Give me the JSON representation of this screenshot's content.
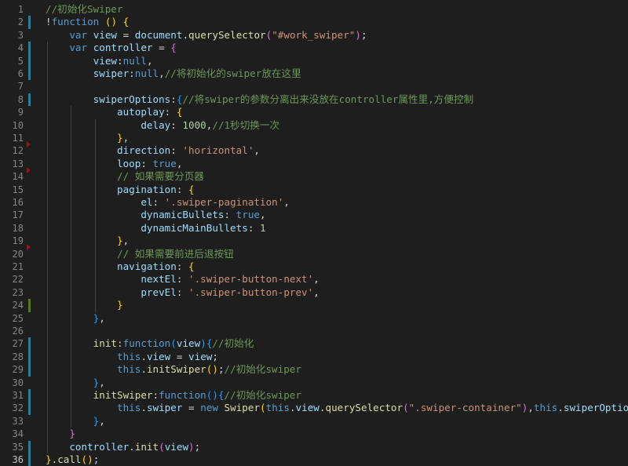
{
  "colors": {
    "background": "#1e1e1e",
    "comment": "#6a9955",
    "keyword": "#569cd6",
    "function": "#dcdcaa",
    "variable": "#9cdcfe",
    "string": "#ce9178",
    "number": "#b5cea8",
    "bracket_1": "#ffd700",
    "bracket_2": "#da70d6",
    "bracket_3": "#179fff",
    "diff_modified": "#1b81a8",
    "diff_added": "#587c0c",
    "diff_deleted": "#94151b"
  },
  "editor": {
    "active_line": 36,
    "lines": [
      {
        "n": "1",
        "gutter": "",
        "tokens": [
          [
            "com",
            "//初始化Swiper"
          ]
        ]
      },
      {
        "n": "2",
        "gutter": "mod",
        "tokens": [
          [
            "pun",
            "!"
          ],
          [
            "kw",
            "function"
          ],
          [
            "pun",
            " "
          ],
          [
            "p1",
            "()"
          ],
          [
            "pun",
            " "
          ],
          [
            "p1",
            "{"
          ]
        ]
      },
      {
        "n": "3",
        "gutter": "",
        "tokens": [
          [
            "pun",
            "    "
          ],
          [
            "kw",
            "var"
          ],
          [
            "pun",
            " "
          ],
          [
            "var",
            "view"
          ],
          [
            "pun",
            " = "
          ],
          [
            "var",
            "document"
          ],
          [
            "pun",
            "."
          ],
          [
            "fn",
            "querySelector"
          ],
          [
            "p2",
            "("
          ],
          [
            "str",
            "\"#work_swiper\""
          ],
          [
            "p2",
            ")"
          ],
          [
            "pun",
            ";"
          ]
        ]
      },
      {
        "n": "4",
        "gutter": "mod",
        "tokens": [
          [
            "pun",
            "    "
          ],
          [
            "kw",
            "var"
          ],
          [
            "pun",
            " "
          ],
          [
            "var",
            "controller"
          ],
          [
            "pun",
            " = "
          ],
          [
            "p2",
            "{"
          ]
        ]
      },
      {
        "n": "5",
        "gutter": "mod",
        "tokens": [
          [
            "pun",
            "        "
          ],
          [
            "var",
            "view"
          ],
          [
            "pun",
            ":"
          ],
          [
            "kw",
            "null"
          ],
          [
            "pun",
            ","
          ]
        ]
      },
      {
        "n": "6",
        "gutter": "mod",
        "tokens": [
          [
            "pun",
            "        "
          ],
          [
            "var",
            "swiper"
          ],
          [
            "pun",
            ":"
          ],
          [
            "kw",
            "null"
          ],
          [
            "pun",
            ","
          ],
          [
            "com",
            "//将初始化的swiper放在这里"
          ]
        ]
      },
      {
        "n": "7",
        "gutter": "",
        "tokens": []
      },
      {
        "n": "8",
        "gutter": "mod",
        "tokens": [
          [
            "pun",
            "        "
          ],
          [
            "var",
            "swiperOptions"
          ],
          [
            "pun",
            ":"
          ],
          [
            "p3",
            "{"
          ],
          [
            "com",
            "//将swiper的参数分离出来没放在controller属性里,方便控制"
          ]
        ]
      },
      {
        "n": "9",
        "gutter": "",
        "tokens": [
          [
            "pun",
            "            "
          ],
          [
            "var",
            "autoplay"
          ],
          [
            "pun",
            ": "
          ],
          [
            "p1",
            "{"
          ]
        ]
      },
      {
        "n": "10",
        "gutter": "",
        "tokens": [
          [
            "pun",
            "                "
          ],
          [
            "var",
            "delay"
          ],
          [
            "pun",
            ": "
          ],
          [
            "num",
            "1000"
          ],
          [
            "pun",
            ","
          ],
          [
            "com",
            "//1秒切换一次"
          ]
        ]
      },
      {
        "n": "11",
        "gutter": "del",
        "tokens": [
          [
            "pun",
            "            "
          ],
          [
            "p1",
            "}"
          ],
          [
            "pun",
            ","
          ]
        ]
      },
      {
        "n": "12",
        "gutter": "",
        "tokens": [
          [
            "pun",
            "            "
          ],
          [
            "var",
            "direction"
          ],
          [
            "pun",
            ": "
          ],
          [
            "str",
            "'horizontal'"
          ],
          [
            "pun",
            ","
          ]
        ]
      },
      {
        "n": "13",
        "gutter": "del",
        "tokens": [
          [
            "pun",
            "            "
          ],
          [
            "var",
            "loop"
          ],
          [
            "pun",
            ": "
          ],
          [
            "kw",
            "true"
          ],
          [
            "pun",
            ","
          ]
        ]
      },
      {
        "n": "14",
        "gutter": "",
        "tokens": [
          [
            "pun",
            "            "
          ],
          [
            "com",
            "// 如果需要分页器"
          ]
        ]
      },
      {
        "n": "15",
        "gutter": "",
        "tokens": [
          [
            "pun",
            "            "
          ],
          [
            "var",
            "pagination"
          ],
          [
            "pun",
            ": "
          ],
          [
            "p1",
            "{"
          ]
        ]
      },
      {
        "n": "16",
        "gutter": "",
        "tokens": [
          [
            "pun",
            "                "
          ],
          [
            "var",
            "el"
          ],
          [
            "pun",
            ": "
          ],
          [
            "str",
            "'.swiper-pagination'"
          ],
          [
            "pun",
            ","
          ]
        ]
      },
      {
        "n": "17",
        "gutter": "",
        "tokens": [
          [
            "pun",
            "                "
          ],
          [
            "var",
            "dynamicBullets"
          ],
          [
            "pun",
            ": "
          ],
          [
            "kw",
            "true"
          ],
          [
            "pun",
            ","
          ]
        ]
      },
      {
        "n": "18",
        "gutter": "",
        "tokens": [
          [
            "pun",
            "                "
          ],
          [
            "var",
            "dynamicMainBullets"
          ],
          [
            "pun",
            ": "
          ],
          [
            "num",
            "1"
          ]
        ]
      },
      {
        "n": "19",
        "gutter": "del",
        "tokens": [
          [
            "pun",
            "            "
          ],
          [
            "p1",
            "}"
          ],
          [
            "pun",
            ","
          ]
        ]
      },
      {
        "n": "20",
        "gutter": "",
        "tokens": [
          [
            "pun",
            "            "
          ],
          [
            "com",
            "// 如果需要前进后退按钮"
          ]
        ]
      },
      {
        "n": "21",
        "gutter": "",
        "tokens": [
          [
            "pun",
            "            "
          ],
          [
            "var",
            "navigation"
          ],
          [
            "pun",
            ": "
          ],
          [
            "p1",
            "{"
          ]
        ]
      },
      {
        "n": "22",
        "gutter": "",
        "tokens": [
          [
            "pun",
            "                "
          ],
          [
            "var",
            "nextEl"
          ],
          [
            "pun",
            ": "
          ],
          [
            "str",
            "'.swiper-button-next'"
          ],
          [
            "pun",
            ","
          ]
        ]
      },
      {
        "n": "23",
        "gutter": "",
        "tokens": [
          [
            "pun",
            "                "
          ],
          [
            "var",
            "prevEl"
          ],
          [
            "pun",
            ": "
          ],
          [
            "str",
            "'.swiper-button-prev'"
          ],
          [
            "pun",
            ","
          ]
        ]
      },
      {
        "n": "24",
        "gutter": "add",
        "tokens": [
          [
            "pun",
            "            "
          ],
          [
            "p1",
            "}"
          ]
        ]
      },
      {
        "n": "25",
        "gutter": "",
        "tokens": [
          [
            "pun",
            "        "
          ],
          [
            "p3",
            "}"
          ],
          [
            "pun",
            ","
          ]
        ]
      },
      {
        "n": "26",
        "gutter": "",
        "tokens": []
      },
      {
        "n": "27",
        "gutter": "mod",
        "tokens": [
          [
            "pun",
            "        "
          ],
          [
            "fn",
            "init"
          ],
          [
            "pun",
            ":"
          ],
          [
            "kw",
            "function"
          ],
          [
            "p3",
            "("
          ],
          [
            "var",
            "view"
          ],
          [
            "p3",
            ")"
          ],
          [
            "p3",
            "{"
          ],
          [
            "com",
            "//初始化"
          ]
        ]
      },
      {
        "n": "28",
        "gutter": "mod",
        "tokens": [
          [
            "pun",
            "            "
          ],
          [
            "kw",
            "this"
          ],
          [
            "pun",
            "."
          ],
          [
            "var",
            "view"
          ],
          [
            "pun",
            " = "
          ],
          [
            "var",
            "view"
          ],
          [
            "pun",
            ";"
          ]
        ]
      },
      {
        "n": "29",
        "gutter": "mod",
        "tokens": [
          [
            "pun",
            "            "
          ],
          [
            "kw",
            "this"
          ],
          [
            "pun",
            "."
          ],
          [
            "fn",
            "initSwiper"
          ],
          [
            "p1",
            "()"
          ],
          [
            "pun",
            ";"
          ],
          [
            "com",
            "//初始化swiper"
          ]
        ]
      },
      {
        "n": "30",
        "gutter": "",
        "tokens": [
          [
            "pun",
            "        "
          ],
          [
            "p3",
            "}"
          ],
          [
            "pun",
            ","
          ]
        ]
      },
      {
        "n": "31",
        "gutter": "mod",
        "tokens": [
          [
            "pun",
            "        "
          ],
          [
            "fn",
            "initSwiper"
          ],
          [
            "pun",
            ":"
          ],
          [
            "kw",
            "function"
          ],
          [
            "p3",
            "()"
          ],
          [
            "p3",
            "{"
          ],
          [
            "com",
            "//初始化swiper"
          ]
        ]
      },
      {
        "n": "32",
        "gutter": "mod",
        "tokens": [
          [
            "pun",
            "            "
          ],
          [
            "kw",
            "this"
          ],
          [
            "pun",
            "."
          ],
          [
            "var",
            "swiper"
          ],
          [
            "pun",
            " = "
          ],
          [
            "kw",
            "new"
          ],
          [
            "pun",
            " "
          ],
          [
            "fn",
            "Swiper"
          ],
          [
            "p1",
            "("
          ],
          [
            "kw",
            "this"
          ],
          [
            "pun",
            "."
          ],
          [
            "var",
            "view"
          ],
          [
            "pun",
            "."
          ],
          [
            "fn",
            "querySelector"
          ],
          [
            "p2",
            "("
          ],
          [
            "str",
            "\".swiper-container\""
          ],
          [
            "p2",
            ")"
          ],
          [
            "pun",
            ","
          ],
          [
            "kw",
            "this"
          ],
          [
            "pun",
            "."
          ],
          [
            "var",
            "swiperOptions"
          ],
          [
            "p1",
            ")"
          ]
        ]
      },
      {
        "n": "33",
        "gutter": "",
        "tokens": [
          [
            "pun",
            "        "
          ],
          [
            "p3",
            "}"
          ],
          [
            "pun",
            ","
          ]
        ]
      },
      {
        "n": "34",
        "gutter": "",
        "tokens": [
          [
            "pun",
            "    "
          ],
          [
            "p2",
            "}"
          ]
        ]
      },
      {
        "n": "35",
        "gutter": "mod",
        "tokens": [
          [
            "pun",
            "    "
          ],
          [
            "var",
            "controller"
          ],
          [
            "pun",
            "."
          ],
          [
            "fn",
            "init"
          ],
          [
            "p2",
            "("
          ],
          [
            "var",
            "view"
          ],
          [
            "p2",
            ")"
          ],
          [
            "pun",
            ";"
          ]
        ]
      },
      {
        "n": "36",
        "gutter": "mod",
        "tokens": [
          [
            "p1",
            "}"
          ],
          [
            "pun",
            "."
          ],
          [
            "fn",
            "call"
          ],
          [
            "p1",
            "()"
          ],
          [
            "pun",
            ";"
          ]
        ]
      }
    ]
  }
}
